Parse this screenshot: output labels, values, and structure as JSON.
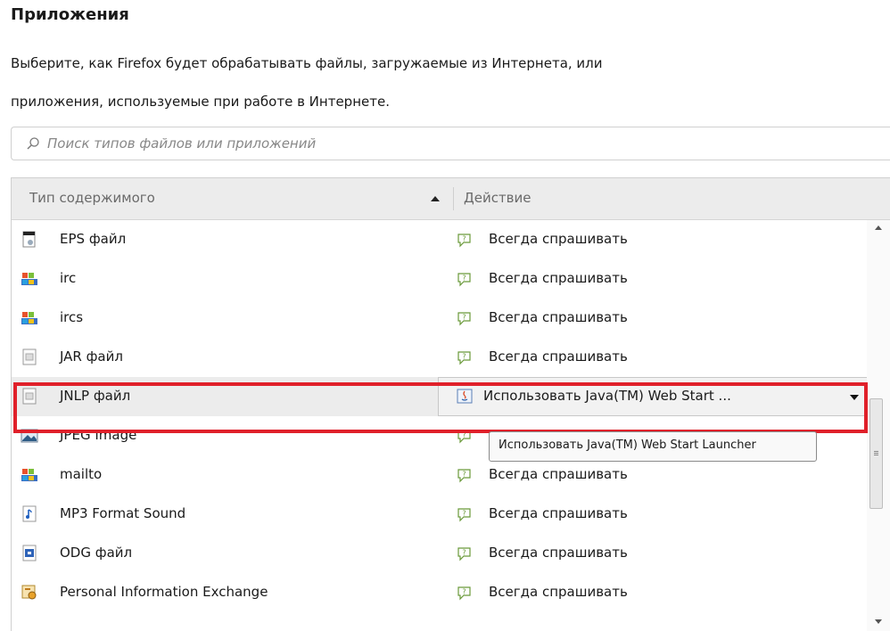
{
  "heading": "Приложения",
  "description": {
    "line1": "Выберите, как Firefox будет обрабатывать файлы, загружаемые из Интернета, или",
    "line2": "приложения, используемые при работе в Интернете."
  },
  "search": {
    "placeholder": "Поиск типов файлов или приложений",
    "icon": "search-icon"
  },
  "table": {
    "columns": {
      "content_type": "Тип содержимого",
      "action": "Действие"
    },
    "sort": "ascending",
    "rows": [
      {
        "name": "EPS файл",
        "icon": "eps-file-icon",
        "action": "Всегда спрашивать"
      },
      {
        "name": "irc",
        "icon": "irc-app-icon",
        "action": "Всегда спрашивать"
      },
      {
        "name": "ircs",
        "icon": "ircs-app-icon",
        "action": "Всегда спрашивать"
      },
      {
        "name": "JAR файл",
        "icon": "jar-file-icon",
        "action": "Всегда спрашивать"
      },
      {
        "name": "JNLP файл",
        "icon": "jnlp-file-icon",
        "action": "Использовать Java(TM) Web Start ...",
        "selected": true
      },
      {
        "name": "JPEG Image",
        "icon": "jpeg-image-icon",
        "action": ""
      },
      {
        "name": "mailto",
        "icon": "mailto-app-icon",
        "action": "Всегда спрашивать"
      },
      {
        "name": "MP3 Format Sound",
        "icon": "mp3-sound-icon",
        "action": "Всегда спрашивать"
      },
      {
        "name": "ODG файл",
        "icon": "odg-file-icon",
        "action": "Всегда спрашивать"
      },
      {
        "name": "Personal Information Exchange",
        "icon": "pfx-file-icon",
        "action": "Всегда спрашивать"
      }
    ]
  },
  "tooltip": "Использовать Java(TM) Web Start Launcher",
  "colors": {
    "highlight": "#e0202a",
    "header_bg": "#ececec"
  }
}
